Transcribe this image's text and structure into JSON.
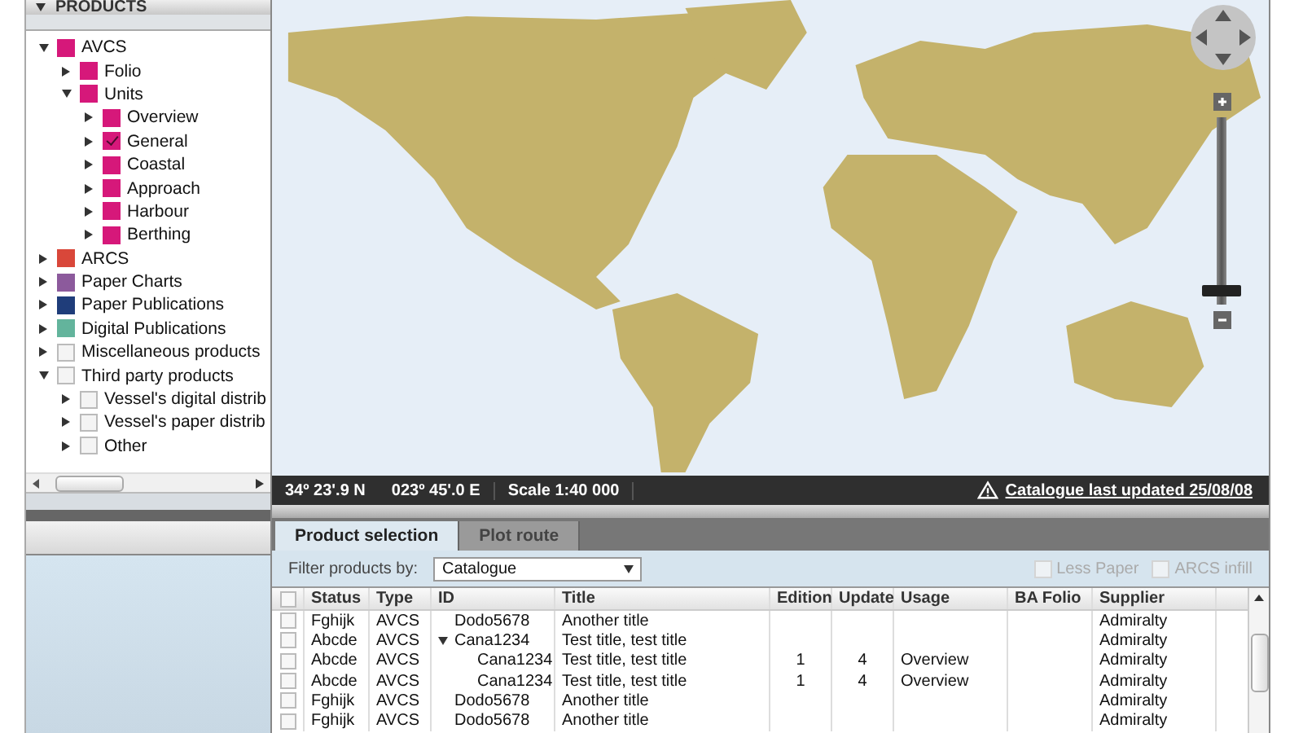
{
  "sidebar": {
    "title": "PRODUCTS",
    "expanded": true,
    "tree": [
      {
        "label": "AVCS",
        "expanded": true,
        "checked": false,
        "color": "#d6187a",
        "children": [
          {
            "label": "Folio",
            "expanded": false,
            "checked": false,
            "color": "#d6187a"
          },
          {
            "label": "Units",
            "expanded": true,
            "checked": false,
            "color": "#d6187a",
            "children": [
              {
                "label": "Overview",
                "expanded": false,
                "checked": false,
                "color": "#d6187a"
              },
              {
                "label": "General",
                "expanded": false,
                "checked": true,
                "color": "#d6187a"
              },
              {
                "label": "Coastal",
                "expanded": false,
                "checked": false,
                "color": "#d6187a"
              },
              {
                "label": "Approach",
                "expanded": false,
                "checked": false,
                "color": "#d6187a"
              },
              {
                "label": "Harbour",
                "expanded": false,
                "checked": false,
                "color": "#d6187a"
              },
              {
                "label": "Berthing",
                "expanded": false,
                "checked": false,
                "color": "#d6187a"
              }
            ]
          }
        ]
      },
      {
        "label": "ARCS",
        "expanded": false,
        "checked": false,
        "color": "#d9473a"
      },
      {
        "label": "Paper Charts",
        "expanded": false,
        "checked": false,
        "color": "#8c5a9c"
      },
      {
        "label": "Paper Publications",
        "expanded": false,
        "checked": false,
        "color": "#1f3d7a"
      },
      {
        "label": "Digital Publications",
        "expanded": false,
        "checked": false,
        "color": "#63b49c"
      },
      {
        "label": "Miscellaneous products",
        "expanded": false,
        "checked": false
      },
      {
        "label": "Third party products",
        "expanded": true,
        "checked": false,
        "children": [
          {
            "label": "Vessel's digital distrib",
            "expanded": false,
            "checked": false
          },
          {
            "label": "Vessel's paper distrib",
            "expanded": false,
            "checked": false
          },
          {
            "label": "Other",
            "expanded": false,
            "checked": false
          }
        ]
      }
    ]
  },
  "map": {
    "zoom": {
      "level": 0.04
    },
    "status_bar": {
      "latitude": "34º 23'.9 N",
      "longitude": "023º 45'.0 E",
      "scale": "Scale 1:40 000",
      "catalogue_link": "Catalogue last updated  25/08/08"
    }
  },
  "tabs": [
    {
      "label": "Product selection",
      "selected": true
    },
    {
      "label": "Plot route",
      "selected": false
    }
  ],
  "filter": {
    "label": "Filter products by:",
    "value": "Catalogue",
    "options": [
      {
        "label": "Less Paper",
        "checked": false,
        "disabled": true
      },
      {
        "label": "ARCS infill",
        "checked": false,
        "disabled": true
      }
    ]
  },
  "table": {
    "select_all": {
      "checked": false
    },
    "columns": [
      "Status",
      "Type",
      "ID",
      "Title",
      "Edition",
      "Update",
      "Usage",
      "BA Folio",
      "Supplier"
    ],
    "rows": [
      {
        "checked": false,
        "cells": [
          "Fghijk",
          "AVCS",
          "Dodo5678",
          "Another title",
          "",
          "",
          "",
          "",
          "Admiralty"
        ]
      },
      {
        "checked": false,
        "expanded": true,
        "cells": [
          "Abcde",
          "AVCS",
          "Cana1234",
          "Test title, test title",
          "",
          "",
          "",
          "",
          "Admiralty"
        ],
        "children": [
          {
            "checked": false,
            "cells": [
              "Abcde",
              "AVCS",
              "Cana1234",
              "Test title, test title",
              "1",
              "4",
              "Overview",
              "",
              "Admiralty"
            ]
          },
          {
            "checked": false,
            "cells": [
              "Abcde",
              "AVCS",
              "Cana1234",
              "Test title, test title",
              "1",
              "4",
              "Overview",
              "",
              "Admiralty"
            ]
          }
        ]
      },
      {
        "checked": false,
        "cells": [
          "Fghijk",
          "AVCS",
          "Dodo5678",
          "Another title",
          "",
          "",
          "",
          "",
          "Admiralty"
        ]
      },
      {
        "checked": false,
        "cells": [
          "Fghijk",
          "AVCS",
          "Dodo5678",
          "Another title",
          "",
          "",
          "",
          "",
          "Admiralty"
        ]
      }
    ]
  }
}
